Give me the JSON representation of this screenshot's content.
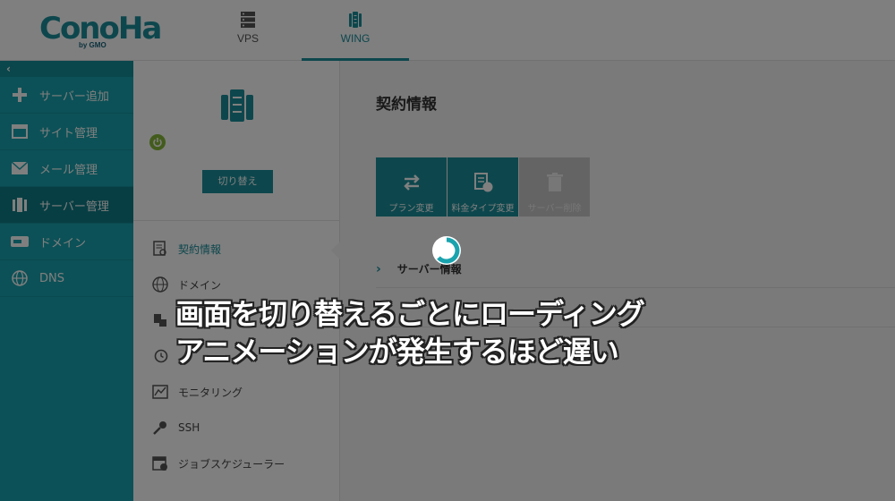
{
  "brand": {
    "logo_text": "ConoHa",
    "logo_sub": "by GMO",
    "accent": "#1a8e9a"
  },
  "top_tabs": [
    {
      "label": "VPS",
      "icon": "server-stack-icon"
    },
    {
      "label": "WING",
      "icon": "wing-server-icon",
      "active": true
    }
  ],
  "sidebar": {
    "collapse_glyph": "‹",
    "items": [
      {
        "label": "サーバー追加",
        "icon": "plus-icon"
      },
      {
        "label": "サイト管理",
        "icon": "window-icon"
      },
      {
        "label": "メール管理",
        "icon": "mail-icon"
      },
      {
        "label": "サーバー管理",
        "icon": "server-icon",
        "active": true
      },
      {
        "label": "ドメイン",
        "icon": "domain-icon"
      },
      {
        "label": "DNS",
        "icon": "globe-icon"
      }
    ]
  },
  "mid_panel": {
    "switch_label": "切り替え",
    "items": [
      {
        "label": "契約情報",
        "icon": "contract-icon",
        "active": true
      },
      {
        "label": "ドメイン",
        "icon": "www-icon"
      },
      {
        "label": "",
        "icon": "transfer-icon"
      },
      {
        "label": "",
        "icon": "history-icon"
      },
      {
        "label": "モニタリング",
        "icon": "chart-icon"
      },
      {
        "label": "SSH",
        "icon": "key-icon"
      },
      {
        "label": "ジョブスケジューラー",
        "icon": "calendar-icon"
      }
    ]
  },
  "main": {
    "title": "契約情報",
    "actions": [
      {
        "label": "プラン変更",
        "icon": "swap-icon"
      },
      {
        "label": "料金タイプ変更",
        "icon": "billing-icon"
      },
      {
        "label": "サーバー削除",
        "icon": "trash-icon",
        "disabled": true
      }
    ],
    "sections": [
      {
        "label": "サーバー情報"
      },
      {
        "label": ""
      }
    ]
  },
  "overlay": {
    "caption_line1": "画面を切り替えるごとにローディング",
    "caption_line2": "アニメーションが発生するほど遅い"
  }
}
